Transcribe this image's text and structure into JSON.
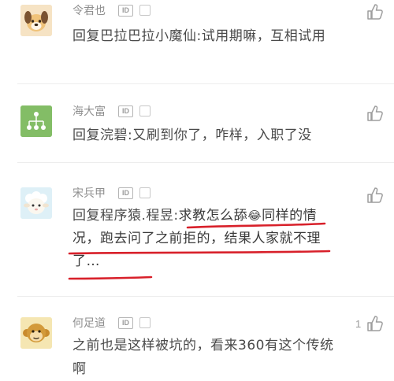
{
  "comments": [
    {
      "username": "令君也",
      "reply_prefix": "回复巴拉巴拉小魔仙:",
      "body": "试用期嘛，互相试用",
      "avatar_icon": "dog-face-icon",
      "id_badge": "ID"
    },
    {
      "username": "海大富",
      "reply_prefix": "回复浣碧:",
      "body": "又刷到你了，咋样，入职了没",
      "avatar_icon": "tree-network-icon",
      "id_badge": "ID"
    },
    {
      "username": "宋兵甲",
      "reply_prefix": "回复程序猿.程昱:",
      "body_part1": "求教怎么舔",
      "emoji": "😂",
      "body_part2": "同样的情况，跑去问了之前拒的，结果人家就不理了…",
      "avatar_icon": "sheep-face-icon",
      "id_badge": "ID"
    },
    {
      "username": "何足道",
      "reply_prefix": "",
      "body": "之前也是这样被坑的，看来360有这个传统啊",
      "avatar_icon": "monkey-face-icon",
      "id_badge": "ID",
      "like_count": "1"
    }
  ],
  "colors": {
    "username": "#8f8f8f",
    "text": "#4a4a4a",
    "annotation": "#d8202a",
    "divider": "#ededed"
  }
}
